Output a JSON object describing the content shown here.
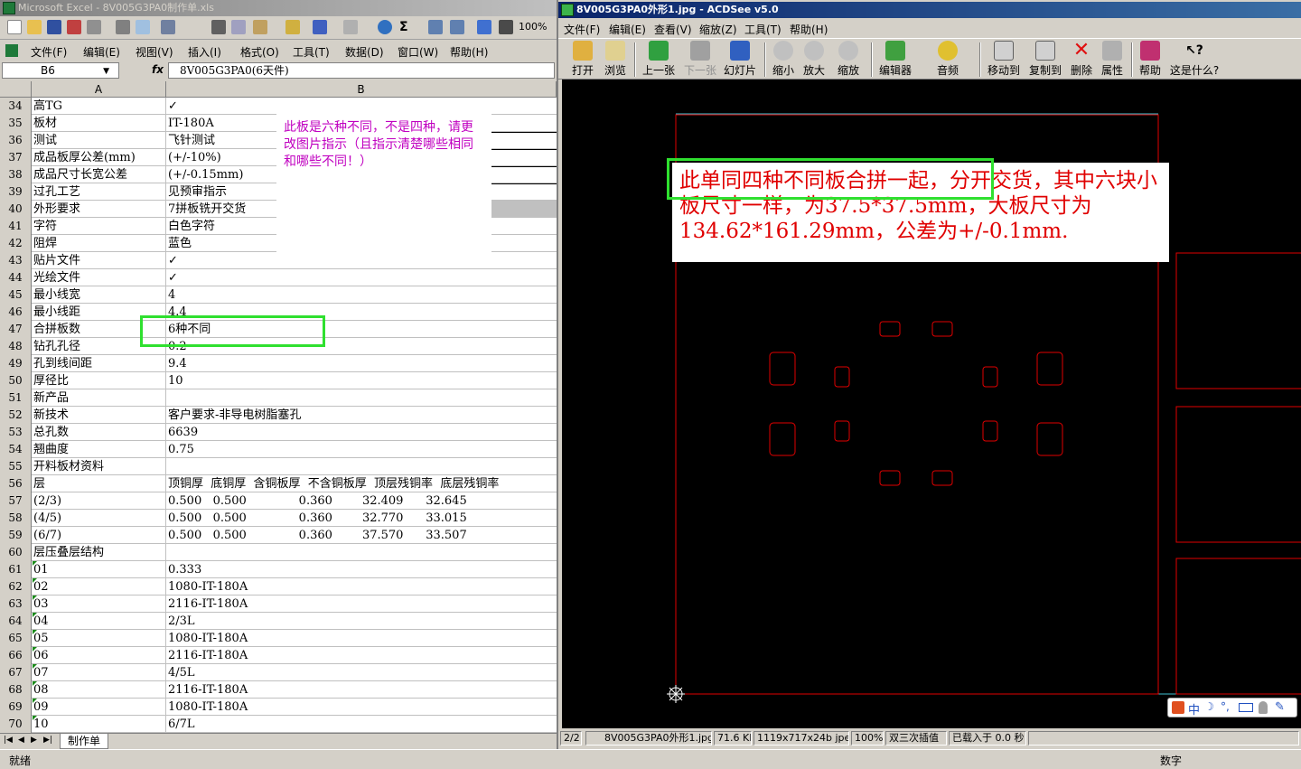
{
  "excel": {
    "title": "Microsoft Excel - 8V005G3PA0制作单.xls",
    "zoom": "100%",
    "menu": [
      "文件(F)",
      "编辑(E)",
      "视图(V)",
      "插入(I)",
      "格式(O)",
      "工具(T)",
      "数据(D)",
      "窗口(W)",
      "帮助(H)"
    ],
    "name_box": "B6",
    "fx": "fx",
    "formula": "8V005G3PA0(6天件)",
    "col_a": "A",
    "col_b": "B",
    "rows": [
      {
        "n": "34",
        "a": "高TG",
        "b": "✓"
      },
      {
        "n": "35",
        "a": "板材",
        "b": "IT-180A"
      },
      {
        "n": "36",
        "a": "测试",
        "b": "飞针测试"
      },
      {
        "n": "37",
        "a": "成品板厚公差(mm)",
        "b": "(+/-10%)"
      },
      {
        "n": "38",
        "a": "成品尺寸长宽公差",
        "b": "(+/-0.15mm)"
      },
      {
        "n": "39",
        "a": "过孔工艺",
        "b": "见预审指示"
      },
      {
        "n": "40",
        "a": "外形要求",
        "b": "7拼板铣开交货"
      },
      {
        "n": "41",
        "a": "字符",
        "b": "白色字符"
      },
      {
        "n": "42",
        "a": "阻焊",
        "b": "蓝色"
      },
      {
        "n": "43",
        "a": "贴片文件",
        "b": "✓"
      },
      {
        "n": "44",
        "a": "光绘文件",
        "b": "✓"
      },
      {
        "n": "45",
        "a": "最小线宽",
        "b": "4"
      },
      {
        "n": "46",
        "a": "最小线距",
        "b": "4.4"
      },
      {
        "n": "47",
        "a": "合拼板数",
        "b": "6种不同"
      },
      {
        "n": "48",
        "a": "钻孔孔径",
        "b": "0.2"
      },
      {
        "n": "49",
        "a": "孔到线间距",
        "b": "9.4"
      },
      {
        "n": "50",
        "a": "厚径比",
        "b": "10"
      },
      {
        "n": "51",
        "a": "新产品",
        "b": ""
      },
      {
        "n": "52",
        "a": "新技术",
        "b": "客户要求-非导电树脂塞孔"
      },
      {
        "n": "53",
        "a": "总孔数",
        "b": "6639"
      },
      {
        "n": "54",
        "a": "翘曲度",
        "b": "0.75"
      },
      {
        "n": "55",
        "a": "开料板材资料",
        "b": ""
      },
      {
        "n": "56",
        "a": "层",
        "b": "顶铜厚  底铜厚  含铜板厚  不含铜板厚  顶层残铜率  底层残铜率"
      },
      {
        "n": "57",
        "a": "(2/3)",
        "b": "0.500   0.500              0.360        32.409      32.645"
      },
      {
        "n": "58",
        "a": "(4/5)",
        "b": "0.500   0.500              0.360        32.770      33.015"
      },
      {
        "n": "59",
        "a": "(6/7)",
        "b": "0.500   0.500              0.360        37.570      33.507"
      },
      {
        "n": "60",
        "a": "层压叠层结构",
        "b": ""
      },
      {
        "n": "61",
        "a": "01",
        "b": "0.333"
      },
      {
        "n": "62",
        "a": "02",
        "b": "1080-IT-180A"
      },
      {
        "n": "63",
        "a": "03",
        "b": "2116-IT-180A"
      },
      {
        "n": "64",
        "a": "04",
        "b": "2/3L"
      },
      {
        "n": "65",
        "a": "05",
        "b": "1080-IT-180A"
      },
      {
        "n": "66",
        "a": "06",
        "b": "2116-IT-180A"
      },
      {
        "n": "67",
        "a": "07",
        "b": "4/5L"
      },
      {
        "n": "68",
        "a": "08",
        "b": "2116-IT-180A"
      },
      {
        "n": "69",
        "a": "09",
        "b": "1080-IT-180A"
      },
      {
        "n": "70",
        "a": "10",
        "b": "6/7L"
      }
    ],
    "note": "此板是六种不同，不是四种，请更改图片指示（且指示清楚哪些相同和哪些不同！）",
    "sheet_tab": "制作单",
    "status_left": "就绪",
    "status_right": "数字"
  },
  "acdsee": {
    "title": "8V005G3PA0外形1.jpg - ACDSee v5.0",
    "menu": [
      "文件(F)",
      "编辑(E)",
      "查看(V)",
      "缩放(Z)",
      "工具(T)",
      "帮助(H)"
    ],
    "tools": [
      "打开",
      "浏览",
      "上一张",
      "下一张",
      "幻灯片",
      "缩小",
      "放大",
      "缩放",
      "编辑器",
      "音频",
      "移动到",
      "复制到",
      "删除",
      "属性",
      "帮助",
      "这是什么?"
    ],
    "annotation": "此单同四种不同板合拼一起，分开交货，其中六块小板尺寸一样，为37.5*37.5mm，大板尺寸为134.62*161.29mm，公差为+/-0.1mm.",
    "status": [
      "2/2",
      "8V005G3PA0外形1.jpg",
      "71.6 KB",
      "1119x717x24b jpeg",
      "100%",
      "双三次插值",
      "已载入于 0.0 秒"
    ],
    "ime": "中"
  },
  "colors": {
    "highlight": "#2fe02f",
    "note_text": "#c000c0",
    "annotation_text": "#e00000",
    "outline": "#e00000"
  }
}
